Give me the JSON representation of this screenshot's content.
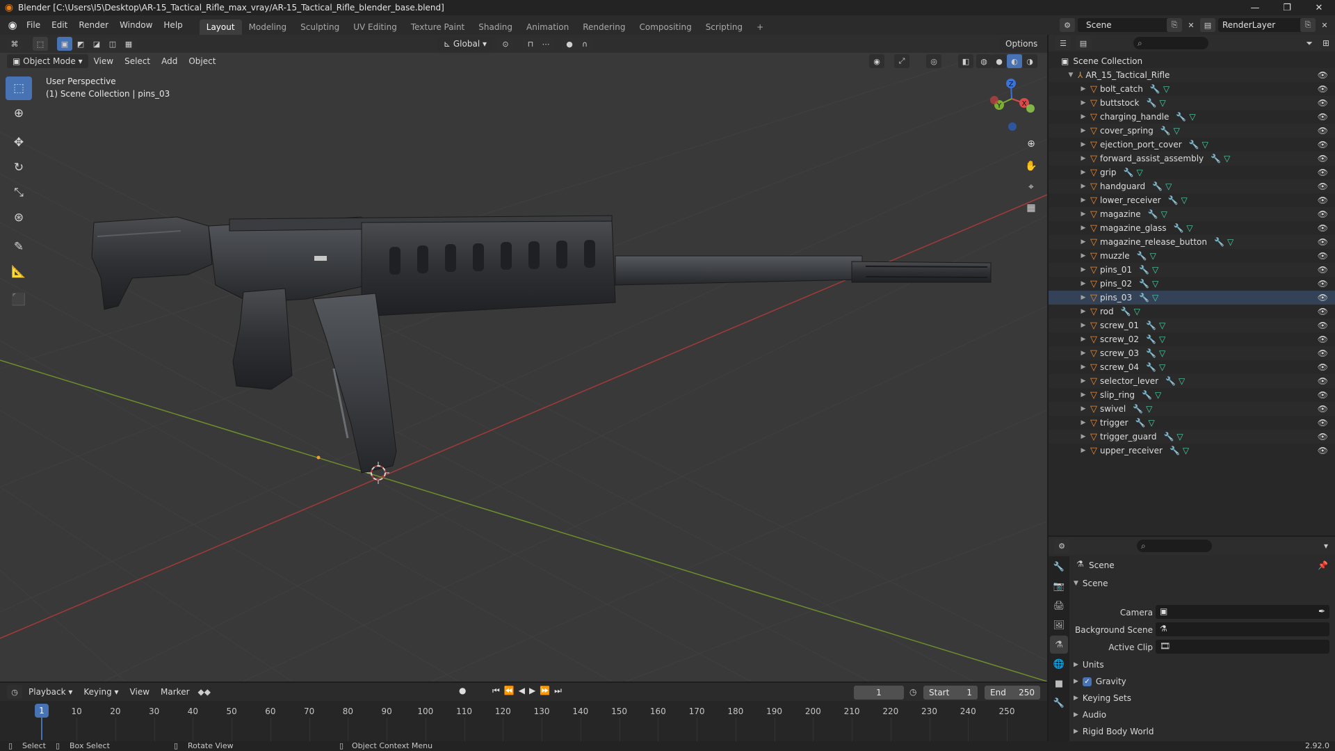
{
  "window": {
    "title": "Blender [C:\\Users\\I5\\Desktop\\AR-15_Tactical_Rifle_max_vray/AR-15_Tactical_Rifle_blender_base.blend]",
    "minimize": "—",
    "maximize": "❐",
    "close": "✕"
  },
  "menu": [
    "File",
    "Edit",
    "Render",
    "Window",
    "Help"
  ],
  "workspaces": [
    "Layout",
    "Modeling",
    "Sculpting",
    "UV Editing",
    "Texture Paint",
    "Shading",
    "Animation",
    "Rendering",
    "Compositing",
    "Scripting"
  ],
  "active_workspace": "Layout",
  "add_workspace": "+",
  "scene_name": "Scene",
  "view_layer": "RenderLayer",
  "viewport": {
    "mode": "Object Mode",
    "menus": [
      "View",
      "Select",
      "Add",
      "Object"
    ],
    "transform_orientation": "Global",
    "options_label": "Options",
    "perspective_label": "User Perspective",
    "collection_label": "(1) Scene Collection | pins_03",
    "gizmo": {
      "x": "X",
      "y": "Y",
      "z": "Z"
    }
  },
  "outliner": {
    "root": "Scene Collection",
    "collection": "AR_15_Tactical_Rifle",
    "objects": [
      "bolt_catch",
      "buttstock",
      "charging_handle",
      "cover_spring",
      "ejection_port_cover",
      "forward_assist_assembly",
      "grip",
      "handguard",
      "lower_receiver",
      "magazine",
      "magazine_glass",
      "magazine_release_button",
      "muzzle",
      "pins_01",
      "pins_02",
      "pins_03",
      "rod",
      "screw_01",
      "screw_02",
      "screw_03",
      "screw_04",
      "selector_lever",
      "slip_ring",
      "swivel",
      "trigger",
      "trigger_guard",
      "upper_receiver"
    ]
  },
  "properties": {
    "context": "Scene",
    "panel": "Scene",
    "camera_label": "Camera",
    "background_label": "Background Scene",
    "clip_label": "Active Clip",
    "sections": [
      "Units",
      "Gravity",
      "Keying Sets",
      "Audio",
      "Rigid Body World"
    ],
    "gravity_checked": "✓"
  },
  "timeline": {
    "menus": [
      "Playback",
      "Keying",
      "View",
      "Marker"
    ],
    "current_frame": "1",
    "start_label": "Start",
    "start_value": "1",
    "end_label": "End",
    "end_value": "250",
    "ticks": [
      "10",
      "20",
      "30",
      "40",
      "50",
      "60",
      "70",
      "80",
      "90",
      "100",
      "110",
      "120",
      "130",
      "140",
      "150",
      "160",
      "170",
      "180",
      "190",
      "200",
      "210",
      "220",
      "230",
      "240",
      "250"
    ],
    "playhead_label": "1"
  },
  "statusbar": {
    "select": "Select",
    "box_select": "Box Select",
    "rotate": "Rotate View",
    "context_menu": "Object Context Menu",
    "version": "2.92.0"
  }
}
